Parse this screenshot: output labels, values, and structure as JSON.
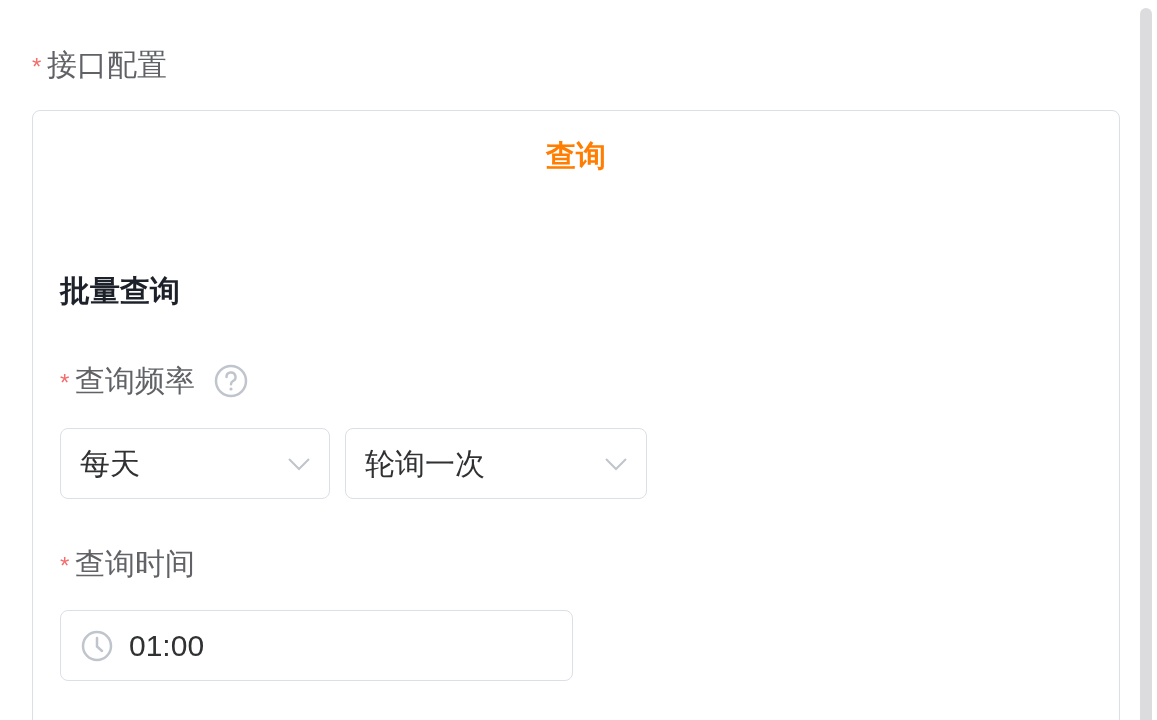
{
  "interface_config": {
    "marker": "*",
    "label": "接口配置",
    "tabs": [
      {
        "label": "查询",
        "selected": true
      }
    ],
    "section": {
      "title": "批量查询",
      "fields": [
        {
          "kind": "selects",
          "marker": "*",
          "label": "查询频率",
          "help": true,
          "selects": [
            {
              "value": "每天"
            },
            {
              "value": "轮询一次"
            }
          ]
        },
        {
          "kind": "time",
          "marker": "*",
          "label": "查询时间",
          "value": "01:00"
        }
      ]
    }
  }
}
